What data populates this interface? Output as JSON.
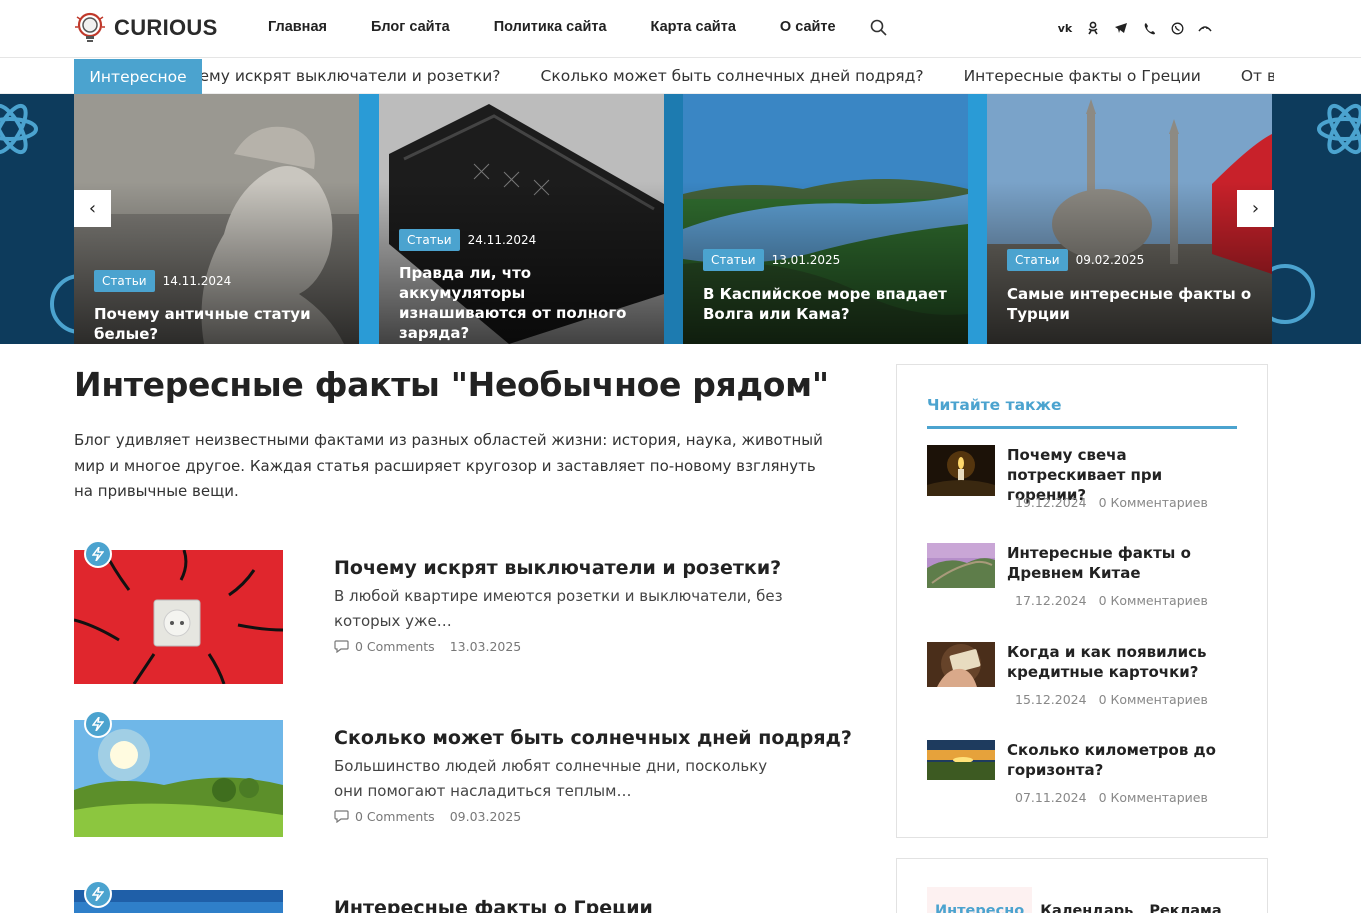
{
  "header": {
    "logo_text": "CURIOUS",
    "nav": [
      "Главная",
      "Блог сайта",
      "Политика сайта",
      "Карта сайта",
      "О сайте"
    ],
    "social": [
      "vk-icon",
      "ok-icon",
      "telegram-icon",
      "viber-icon",
      "whatsapp-icon",
      "max-icon"
    ]
  },
  "ticker": {
    "label": "Интересное",
    "items": [
      "…ему искрят выключатели и розетки?",
      "Сколько может быть солнечных дней подряд?",
      "Интересные факты о Греции",
      "От всех ли газо…"
    ]
  },
  "slider": {
    "prev": "‹",
    "next": "›",
    "slides": [
      {
        "tag": "Статьи",
        "date": "14.11.2024",
        "title": "Почему античные статуи белые?"
      },
      {
        "tag": "Статьи",
        "date": "24.11.2024",
        "title": "Правда ли, что аккумуляторы изнашиваются от полного заряда?"
      },
      {
        "tag": "Статьи",
        "date": "13.01.2025",
        "title": "В Каспийское море впадает Волга или Кама?"
      },
      {
        "tag": "Статьи",
        "date": "09.02.2025",
        "title": "Самые интересные факты о Турции"
      }
    ]
  },
  "main": {
    "title": "Интересные факты \"Необычное рядом\"",
    "intro": "Блог удивляет неизвестными фактами из разных областей жизни: история, наука, животный мир и многое другое. Каждая статья расширяет кругозор и заставляет по-новому взглянуть на привычные вещи.",
    "posts": [
      {
        "title": "Почему искрят выключатели и розетки?",
        "excerpt": "В любой квартире имеются розетки и выключатели, без которых уже…",
        "comments": "0 Comments",
        "date": "13.03.2025"
      },
      {
        "title": "Сколько может быть солнечных дней подряд?",
        "excerpt": "Большинство людей любят солнечные дни, поскольку они помогают насладиться теплым…",
        "comments": "0 Comments",
        "date": "09.03.2025"
      },
      {
        "title": "Интересные факты о Греции"
      }
    ]
  },
  "sidebar": {
    "heading": "Читайте также",
    "items": [
      {
        "title": "Почему свеча потрескивает при горении?",
        "date": "19.12.2024",
        "comments": "0 Комментариев"
      },
      {
        "title": "Интересные факты о Древнем Китае",
        "date": "17.12.2024",
        "comments": "0 Комментариев"
      },
      {
        "title": "Когда и как появились кредитные карточки?",
        "date": "15.12.2024",
        "comments": "0 Комментариев"
      },
      {
        "title": "Сколько километров до горизонта?",
        "date": "07.11.2024",
        "comments": "0 Комментариев"
      }
    ],
    "tabs": [
      "Интересно",
      "Календарь",
      "Реклама"
    ]
  },
  "colors": {
    "accent": "#4ba3cf",
    "slider_bg": "#0d3b5c"
  }
}
